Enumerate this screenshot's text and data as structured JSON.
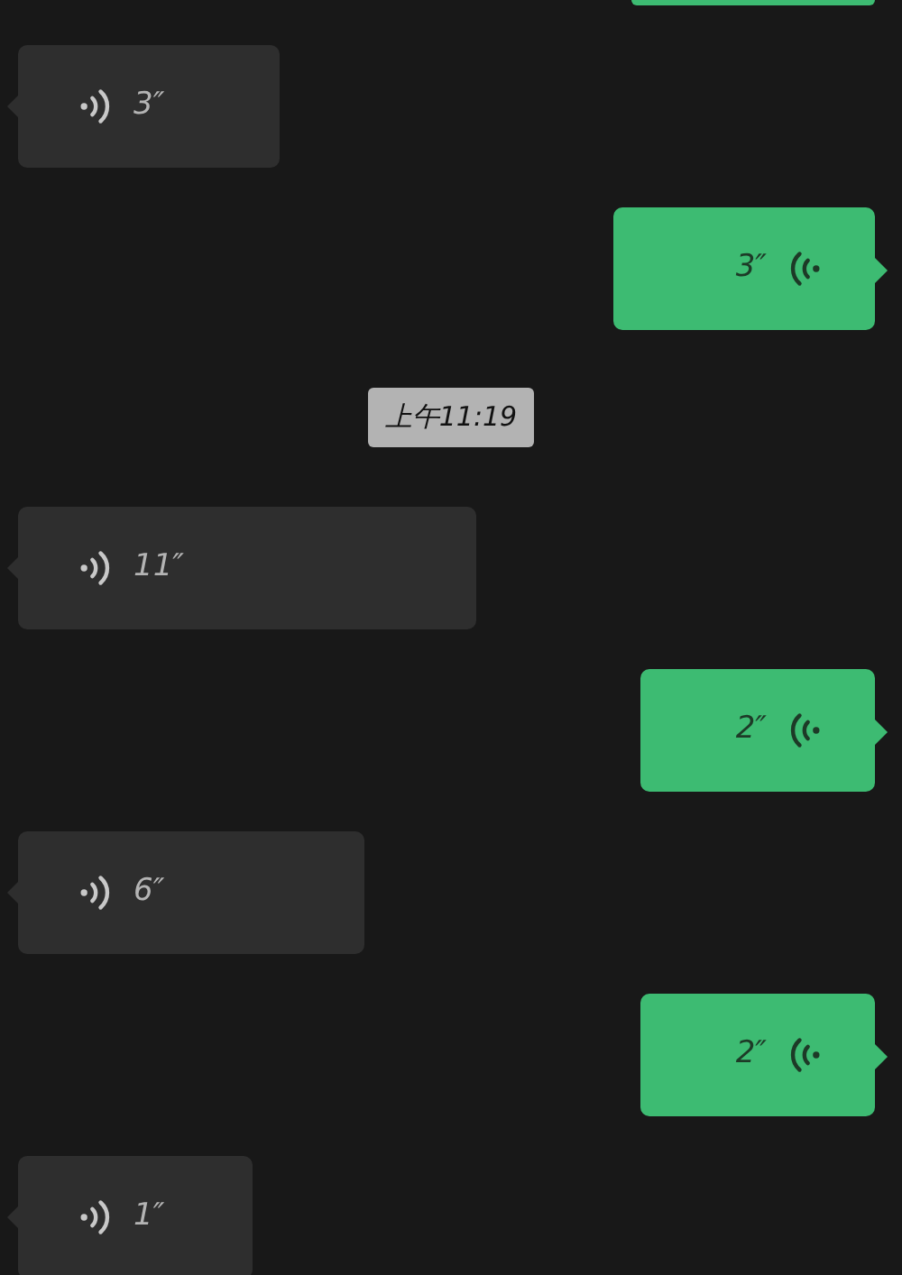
{
  "messages": [
    {
      "kind": "cut",
      "outgoing": true
    },
    {
      "kind": "voice",
      "outgoing": false,
      "duration": "3″"
    },
    {
      "kind": "voice",
      "outgoing": true,
      "duration": "3″"
    },
    {
      "kind": "time",
      "text": "上午11:19"
    },
    {
      "kind": "voice",
      "outgoing": false,
      "duration": "11″"
    },
    {
      "kind": "voice",
      "outgoing": true,
      "duration": "2″"
    },
    {
      "kind": "voice",
      "outgoing": false,
      "duration": "6″"
    },
    {
      "kind": "voice",
      "outgoing": true,
      "duration": "2″"
    },
    {
      "kind": "voice",
      "outgoing": false,
      "duration": "1″"
    }
  ]
}
